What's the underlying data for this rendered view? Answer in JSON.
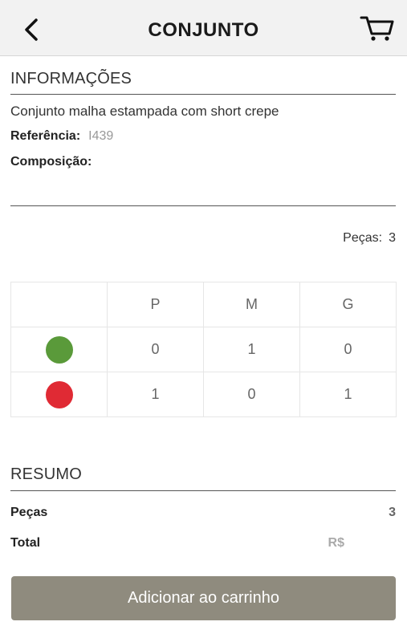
{
  "header": {
    "title": "CONJUNTO"
  },
  "info": {
    "section_title": "INFORMAÇÕES",
    "description": "Conjunto malha estampada com short crepe",
    "reference_label": "Referência:",
    "reference_value": "I439",
    "composition_label": "Composição:",
    "composition_value": ""
  },
  "pieces": {
    "label": "Peças:",
    "count": "3"
  },
  "grid": {
    "sizes": [
      "P",
      "M",
      "G"
    ],
    "rows": [
      {
        "color": "#5a9a3a",
        "values": [
          "0",
          "1",
          "0"
        ]
      },
      {
        "color": "#e02a34",
        "values": [
          "1",
          "0",
          "1"
        ]
      }
    ]
  },
  "summary": {
    "section_title": "RESUMO",
    "pieces_label": "Peças",
    "pieces_value": "3",
    "total_label": "Total",
    "total_value": "R$"
  },
  "actions": {
    "add_to_cart_label": "Adicionar ao carrinho"
  }
}
